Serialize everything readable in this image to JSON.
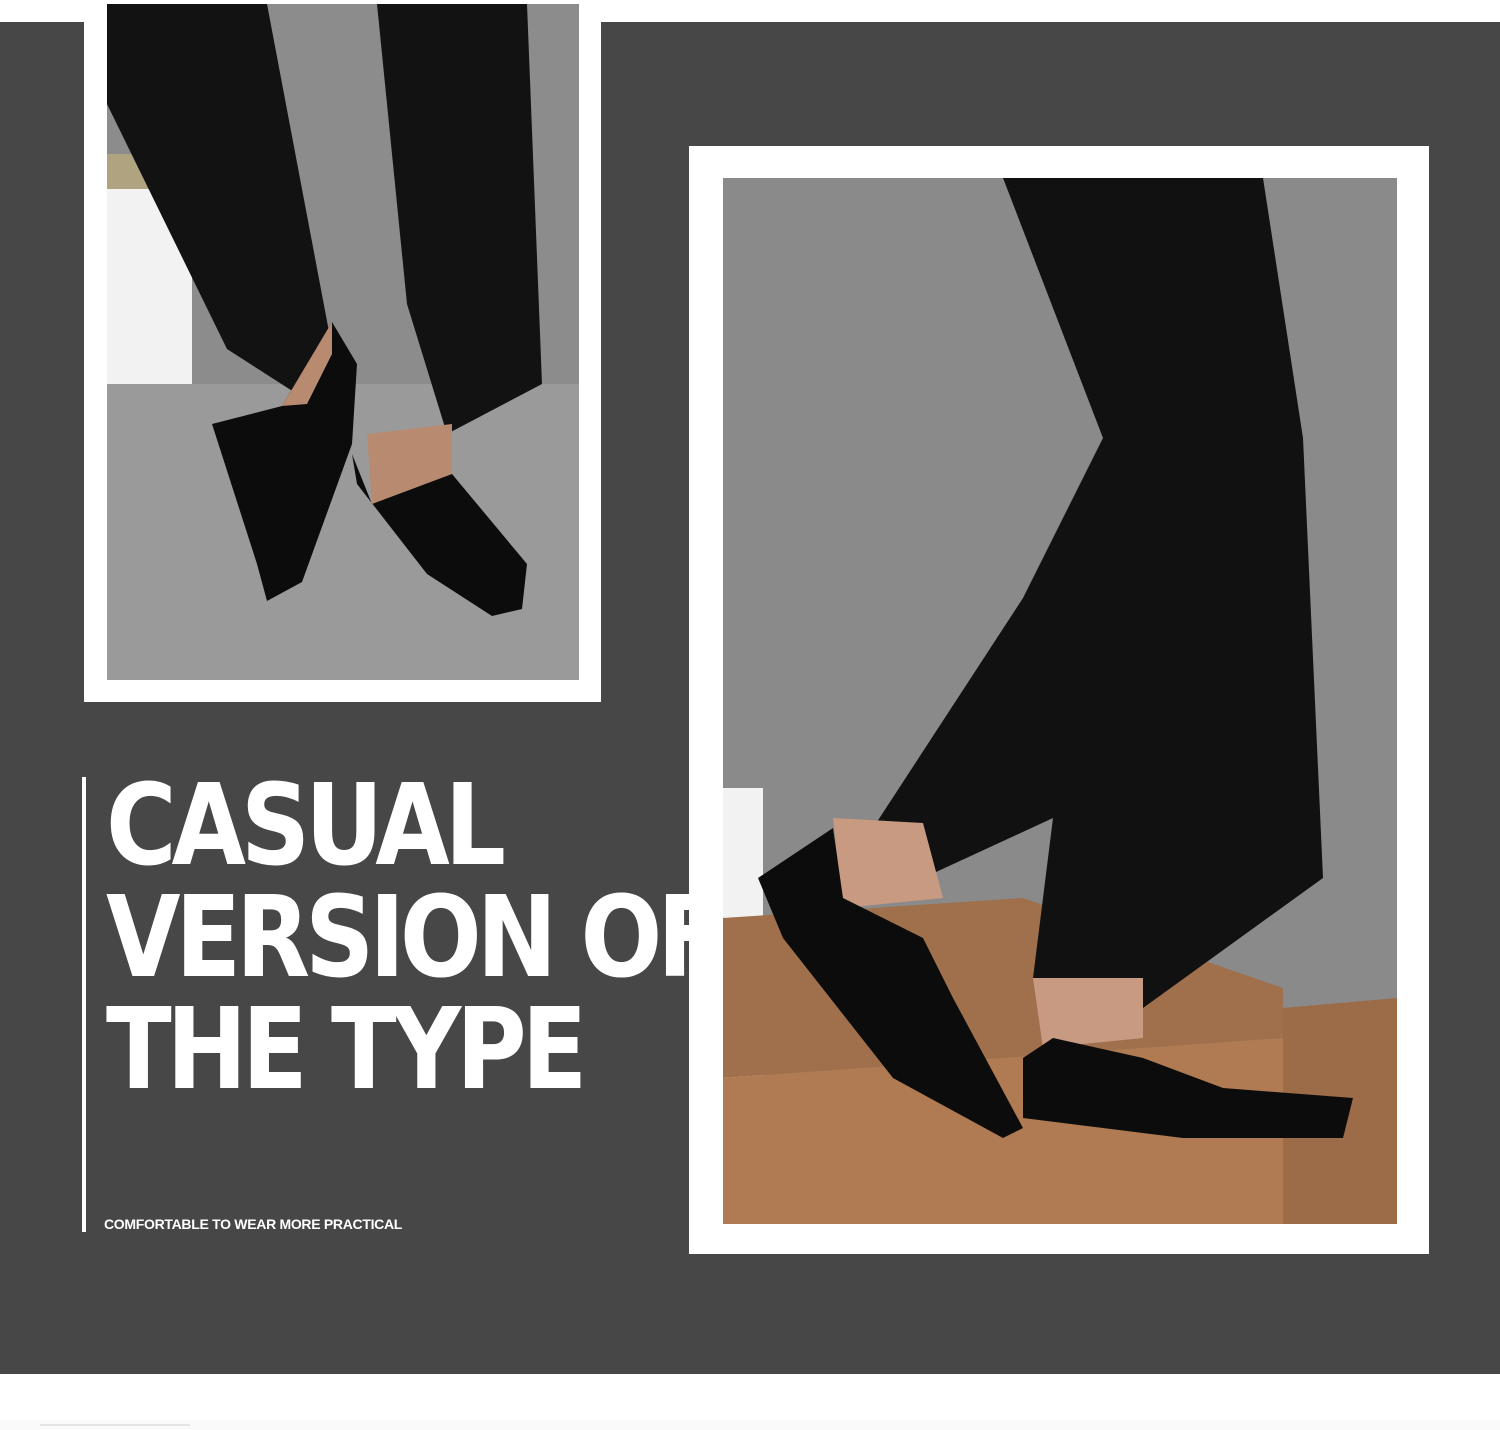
{
  "banner": {
    "headline": [
      "CASUAL",
      "VERSION OF",
      "THE TYPE"
    ],
    "tagline": "COMFORTABLE TO WEAR MORE PRACTICAL"
  },
  "photos": {
    "left": {
      "subject": "black slip-on loafers, two feet on grey floor"
    },
    "right": {
      "subject": "black slip-on loafers stepping up wooden stairs"
    }
  },
  "colors": {
    "panel": "#474747",
    "frame": "#ffffff",
    "text": "#ffffff",
    "shoe": "#0d0d0d",
    "trousers": "#111111",
    "wall": "#8a8a8a",
    "wood": "#9a6b48"
  }
}
